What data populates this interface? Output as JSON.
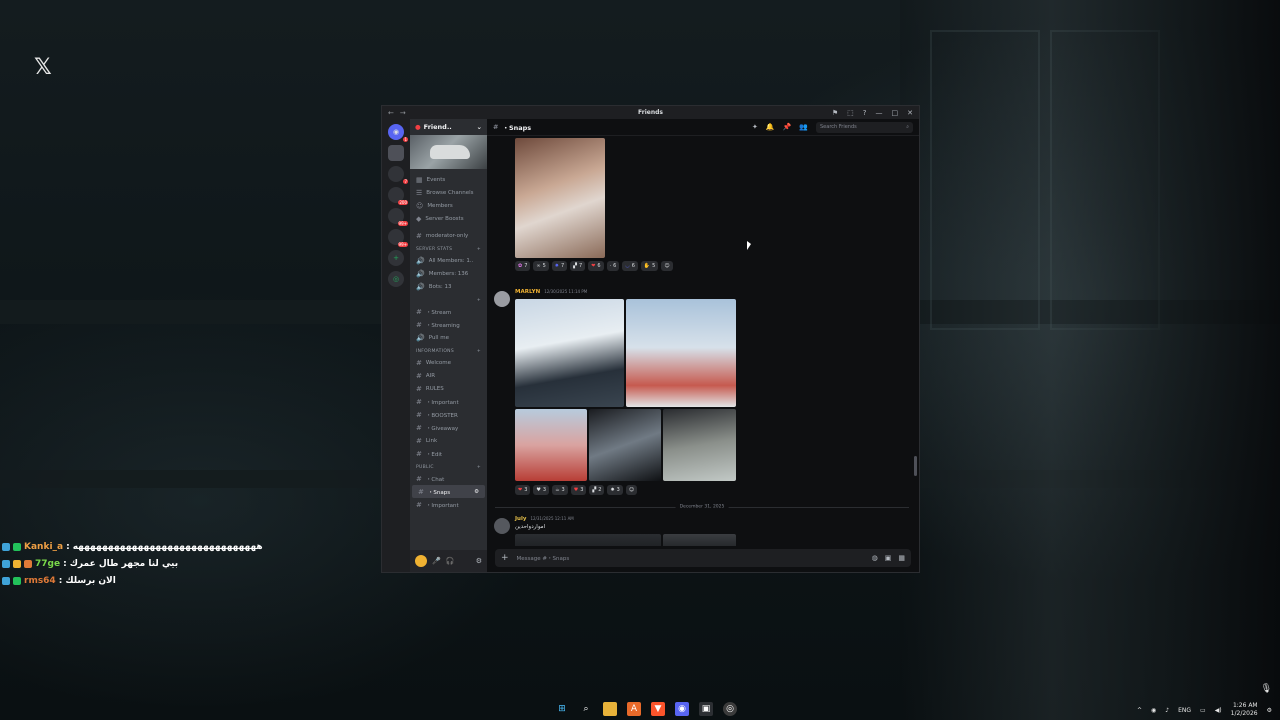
{
  "window": {
    "title": "Friends",
    "controls": [
      "—",
      "□",
      "✕"
    ]
  },
  "guild": {
    "name": "Friend..",
    "menu": [
      {
        "label": "Events",
        "icon": "calendar-icon"
      },
      {
        "label": "Browse Channels",
        "icon": "browse-icon"
      },
      {
        "label": "Members",
        "icon": "members-icon"
      },
      {
        "label": "Server Boosts",
        "icon": "boost-icon"
      }
    ],
    "channels_top": [
      {
        "label": "moderator-only",
        "icon": "#"
      }
    ],
    "categories": [
      {
        "label": "SERVER STATS",
        "items": [
          {
            "label": "All Members: 1..",
            "icon": "🔊"
          },
          {
            "label": "Members: 136",
            "icon": "🔊"
          },
          {
            "label": "Bots: 13",
            "icon": "🔊"
          }
        ]
      },
      {
        "label": "",
        "items": [
          {
            "label": "・Stream",
            "icon": "#"
          },
          {
            "label": "・Streaming",
            "icon": "#"
          },
          {
            "label": "Pull me",
            "icon": "🔊"
          }
        ]
      },
      {
        "label": "INFORMATIONS",
        "items": [
          {
            "label": "Welcome",
            "icon": "#"
          },
          {
            "label": "AIR",
            "icon": "#"
          },
          {
            "label": "RULES",
            "icon": "#"
          },
          {
            "label": "・Important",
            "icon": "#"
          },
          {
            "label": "・BOOSTER",
            "icon": "#"
          },
          {
            "label": "・Giveaway",
            "icon": "#"
          },
          {
            "label": "Link",
            "icon": "#"
          },
          {
            "label": "・Edit",
            "icon": "#"
          }
        ]
      },
      {
        "label": "PUBLIC",
        "items": [
          {
            "label": "・Chat",
            "icon": "#"
          },
          {
            "label": "・Snaps",
            "icon": "#",
            "active": true
          },
          {
            "label": "・Important",
            "icon": "#"
          }
        ]
      }
    ]
  },
  "channel": {
    "name": "・Snaps",
    "search_placeholder": "Search Friends",
    "composer_placeholder": "Message #・Snaps"
  },
  "messages": {
    "reactions_1": [
      "7",
      "5",
      "7",
      "7",
      "6",
      "6",
      "6",
      "5"
    ],
    "msg2_author": "MARLYN",
    "msg2_time": "12/30/2025 11:14 PM",
    "reactions_2": [
      "3",
      "3",
      "3",
      "3",
      "2",
      "3"
    ],
    "date_divider": "December 31, 2025",
    "msg3_author": "July",
    "msg3_time": "12/31/2025 12:11 AM",
    "msg3_text": "اموارد‌واحدين"
  },
  "server_badges": [
    "1",
    "7",
    "200",
    "99+",
    "99+"
  ],
  "chat_overlay": [
    {
      "user": "Kanki_a",
      "color": "#f0a045",
      "text": "هههههههههههههههههههههههههههههههه"
    },
    {
      "user": "77ge",
      "color": "#7ad94a",
      "text": "بيي لنا مجهر طال عمرك"
    },
    {
      "user": "rms64",
      "color": "#e07a38",
      "text": "الان برسلك"
    }
  ],
  "tray": {
    "lang": "ENG",
    "time": "1:26 AM",
    "date": "1/2/2026"
  }
}
